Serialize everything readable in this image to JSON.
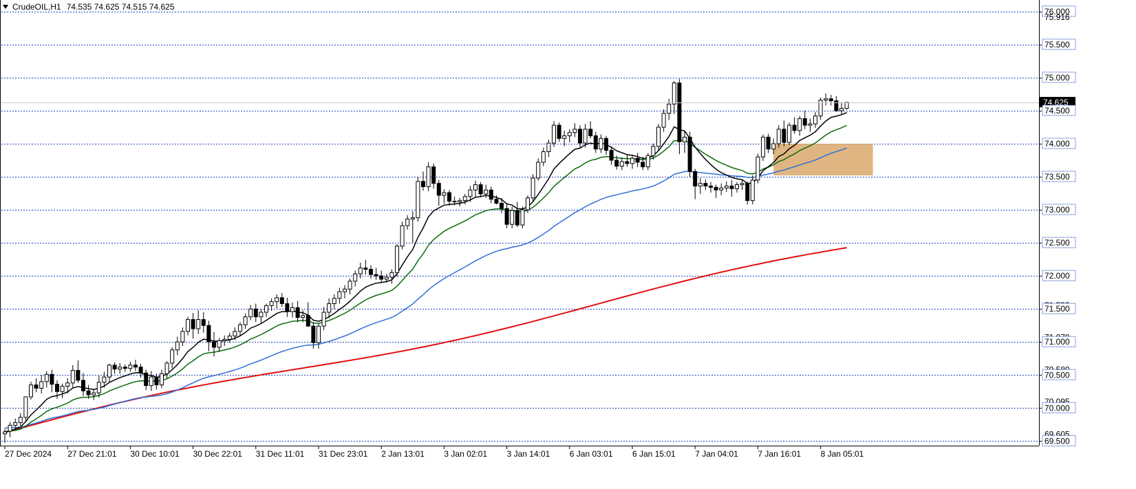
{
  "header": {
    "symbol": "CrudeOIL,H1",
    "ohlc": "74.535 74.625 74.515 74.625"
  },
  "price_scale": {
    "labels": [
      {
        "value": 76.0,
        "text": "76.000",
        "style": "boxed"
      },
      {
        "value": 75.916,
        "text": "75.916",
        "style": "faint"
      },
      {
        "value": 75.5,
        "text": "75.500",
        "style": "boxed"
      },
      {
        "value": 75.0,
        "text": "75.000",
        "style": "boxed"
      },
      {
        "value": 74.625,
        "text": "74.625",
        "style": "current"
      },
      {
        "value": 74.5,
        "text": "74.500",
        "style": "boxed"
      },
      {
        "value": 74.0,
        "text": "74.000",
        "style": "boxed"
      },
      {
        "value": 73.5,
        "text": "73.500",
        "style": "boxed"
      },
      {
        "value": 73.0,
        "text": "73.000",
        "style": "boxed"
      },
      {
        "value": 72.5,
        "text": "72.500",
        "style": "boxed"
      },
      {
        "value": 72.0,
        "text": "72.000",
        "style": "boxed"
      },
      {
        "value": 71.555,
        "text": "71.555",
        "style": "faint"
      },
      {
        "value": 71.5,
        "text": "71.500",
        "style": "boxed"
      },
      {
        "value": 71.07,
        "text": "71.070",
        "style": "faint"
      },
      {
        "value": 71.0,
        "text": "71.000",
        "style": "boxed"
      },
      {
        "value": 70.58,
        "text": "70.580",
        "style": "faint"
      },
      {
        "value": 70.5,
        "text": "70.500",
        "style": "boxed"
      },
      {
        "value": 70.095,
        "text": "70.095",
        "style": "faint"
      },
      {
        "value": 70.0,
        "text": "70.000",
        "style": "boxed"
      },
      {
        "value": 69.605,
        "text": "69.605",
        "style": "faint"
      },
      {
        "value": 69.5,
        "text": "69.500",
        "style": "boxed"
      }
    ]
  },
  "time_axis": {
    "labels": [
      {
        "bar": 0,
        "text": "27 Dec 2024"
      },
      {
        "bar": 12,
        "text": "27 Dec 21:01"
      },
      {
        "bar": 24,
        "text": "30 Dec 10:01"
      },
      {
        "bar": 36,
        "text": "30 Dec 22:01"
      },
      {
        "bar": 48,
        "text": "31 Dec 11:01"
      },
      {
        "bar": 60,
        "text": "31 Dec 23:01"
      },
      {
        "bar": 72,
        "text": "2 Jan 13:01"
      },
      {
        "bar": 84,
        "text": "3 Jan 02:01"
      },
      {
        "bar": 96,
        "text": "3 Jan 14:01"
      },
      {
        "bar": 108,
        "text": "6 Jan 03:01"
      },
      {
        "bar": 120,
        "text": "6 Jan 15:01"
      },
      {
        "bar": 132,
        "text": "7 Jan 04:01"
      },
      {
        "bar": 144,
        "text": "7 Jan 16:01"
      },
      {
        "bar": 156,
        "text": "8 Jan 05:01"
      }
    ]
  },
  "colors": {
    "bull_fill": "#ffffff",
    "bear_fill": "#000000",
    "candle_outline": "#000000",
    "grid": "#1f3fbf",
    "current_price_line": "#c8c8c8",
    "current_price_box": "#000000",
    "zone_fill": "#d9a86c",
    "ma_fast": "#000000",
    "ma_mid": "#0a6b0a",
    "ma_slow": "#2f6fd8",
    "ma_long": "#e01010"
  },
  "chart_data": {
    "type": "candlestick",
    "symbol": "CrudeOIL",
    "timeframe": "H1",
    "ylim": [
      69.41,
      76.05
    ],
    "candles": [
      {
        "o": 69.61,
        "h": 69.69,
        "l": 69.47,
        "c": 69.64
      },
      {
        "o": 69.65,
        "h": 69.79,
        "l": 69.56,
        "c": 69.74
      },
      {
        "o": 69.74,
        "h": 69.84,
        "l": 69.66,
        "c": 69.78
      },
      {
        "o": 69.78,
        "h": 69.92,
        "l": 69.73,
        "c": 69.86
      },
      {
        "o": 69.86,
        "h": 70.08,
        "l": 69.81,
        "c": 70.17
      },
      {
        "o": 70.17,
        "h": 70.4,
        "l": 70.13,
        "c": 70.35
      },
      {
        "o": 70.35,
        "h": 70.45,
        "l": 70.24,
        "c": 70.3
      },
      {
        "o": 70.3,
        "h": 70.5,
        "l": 70.22,
        "c": 70.4
      },
      {
        "o": 70.4,
        "h": 70.56,
        "l": 70.31,
        "c": 70.51
      },
      {
        "o": 70.51,
        "h": 70.58,
        "l": 70.24,
        "c": 70.36
      },
      {
        "o": 70.36,
        "h": 70.42,
        "l": 70.14,
        "c": 70.25
      },
      {
        "o": 70.25,
        "h": 70.37,
        "l": 70.15,
        "c": 70.33
      },
      {
        "o": 70.33,
        "h": 70.45,
        "l": 70.22,
        "c": 70.38
      },
      {
        "o": 70.38,
        "h": 70.65,
        "l": 70.3,
        "c": 70.57
      },
      {
        "o": 70.57,
        "h": 70.72,
        "l": 70.38,
        "c": 70.42
      },
      {
        "o": 70.42,
        "h": 70.53,
        "l": 70.18,
        "c": 70.26
      },
      {
        "o": 70.26,
        "h": 70.35,
        "l": 70.14,
        "c": 70.2
      },
      {
        "o": 70.2,
        "h": 70.28,
        "l": 70.12,
        "c": 70.23
      },
      {
        "o": 70.23,
        "h": 70.49,
        "l": 70.16,
        "c": 70.39
      },
      {
        "o": 70.39,
        "h": 70.55,
        "l": 70.31,
        "c": 70.47
      },
      {
        "o": 70.47,
        "h": 70.67,
        "l": 70.38,
        "c": 70.65
      },
      {
        "o": 70.65,
        "h": 70.69,
        "l": 70.52,
        "c": 70.59
      },
      {
        "o": 70.59,
        "h": 70.68,
        "l": 70.52,
        "c": 70.62
      },
      {
        "o": 70.62,
        "h": 70.66,
        "l": 70.55,
        "c": 70.6
      },
      {
        "o": 70.6,
        "h": 70.7,
        "l": 70.55,
        "c": 70.65
      },
      {
        "o": 70.65,
        "h": 70.73,
        "l": 70.56,
        "c": 70.62
      },
      {
        "o": 70.62,
        "h": 70.67,
        "l": 70.46,
        "c": 70.53
      },
      {
        "o": 70.53,
        "h": 70.58,
        "l": 70.27,
        "c": 70.34
      },
      {
        "o": 70.34,
        "h": 70.56,
        "l": 70.26,
        "c": 70.47
      },
      {
        "o": 70.47,
        "h": 70.52,
        "l": 70.28,
        "c": 70.35
      },
      {
        "o": 70.35,
        "h": 70.58,
        "l": 70.3,
        "c": 70.52
      },
      {
        "o": 70.52,
        "h": 70.71,
        "l": 70.45,
        "c": 70.68
      },
      {
        "o": 70.68,
        "h": 70.92,
        "l": 70.6,
        "c": 70.88
      },
      {
        "o": 70.88,
        "h": 71.08,
        "l": 70.8,
        "c": 71.0
      },
      {
        "o": 71.0,
        "h": 71.22,
        "l": 70.94,
        "c": 71.16
      },
      {
        "o": 71.16,
        "h": 71.38,
        "l": 71.1,
        "c": 71.34
      },
      {
        "o": 71.34,
        "h": 71.44,
        "l": 71.05,
        "c": 71.2
      },
      {
        "o": 71.2,
        "h": 71.48,
        "l": 71.12,
        "c": 71.34
      },
      {
        "o": 71.34,
        "h": 71.45,
        "l": 71.14,
        "c": 71.25
      },
      {
        "o": 71.25,
        "h": 71.32,
        "l": 70.86,
        "c": 71.0
      },
      {
        "o": 71.0,
        "h": 71.15,
        "l": 70.78,
        "c": 70.92
      },
      {
        "o": 70.92,
        "h": 71.06,
        "l": 70.85,
        "c": 71.02
      },
      {
        "o": 71.02,
        "h": 71.1,
        "l": 70.94,
        "c": 71.04
      },
      {
        "o": 71.04,
        "h": 71.14,
        "l": 70.99,
        "c": 71.09
      },
      {
        "o": 71.09,
        "h": 71.22,
        "l": 71.03,
        "c": 71.16
      },
      {
        "o": 71.16,
        "h": 71.3,
        "l": 71.1,
        "c": 71.26
      },
      {
        "o": 71.26,
        "h": 71.43,
        "l": 71.2,
        "c": 71.38
      },
      {
        "o": 71.38,
        "h": 71.56,
        "l": 71.33,
        "c": 71.5
      },
      {
        "o": 71.5,
        "h": 71.58,
        "l": 71.3,
        "c": 71.38
      },
      {
        "o": 71.38,
        "h": 71.5,
        "l": 71.29,
        "c": 71.45
      },
      {
        "o": 71.45,
        "h": 71.58,
        "l": 71.38,
        "c": 71.55
      },
      {
        "o": 71.55,
        "h": 71.66,
        "l": 71.47,
        "c": 71.61
      },
      {
        "o": 71.61,
        "h": 71.72,
        "l": 71.51,
        "c": 71.67
      },
      {
        "o": 71.67,
        "h": 71.74,
        "l": 71.53,
        "c": 71.58
      },
      {
        "o": 71.58,
        "h": 71.67,
        "l": 71.38,
        "c": 71.46
      },
      {
        "o": 71.46,
        "h": 71.6,
        "l": 71.37,
        "c": 71.52
      },
      {
        "o": 71.52,
        "h": 71.62,
        "l": 71.3,
        "c": 71.37
      },
      {
        "o": 71.37,
        "h": 71.48,
        "l": 71.3,
        "c": 71.4
      },
      {
        "o": 71.4,
        "h": 71.6,
        "l": 71.23,
        "c": 71.24
      },
      {
        "o": 71.24,
        "h": 71.3,
        "l": 70.9,
        "c": 70.99
      },
      {
        "o": 70.99,
        "h": 71.28,
        "l": 70.9,
        "c": 71.24
      },
      {
        "o": 71.24,
        "h": 71.53,
        "l": 71.18,
        "c": 71.45
      },
      {
        "o": 71.45,
        "h": 71.66,
        "l": 71.36,
        "c": 71.58
      },
      {
        "o": 71.58,
        "h": 71.72,
        "l": 71.5,
        "c": 71.66
      },
      {
        "o": 71.66,
        "h": 71.82,
        "l": 71.58,
        "c": 71.76
      },
      {
        "o": 71.76,
        "h": 71.86,
        "l": 71.66,
        "c": 71.8
      },
      {
        "o": 71.8,
        "h": 71.96,
        "l": 71.72,
        "c": 71.92
      },
      {
        "o": 71.92,
        "h": 72.08,
        "l": 71.84,
        "c": 72.03
      },
      {
        "o": 72.03,
        "h": 72.2,
        "l": 71.96,
        "c": 72.12
      },
      {
        "o": 72.12,
        "h": 72.24,
        "l": 72.02,
        "c": 72.1
      },
      {
        "o": 72.1,
        "h": 72.16,
        "l": 71.96,
        "c": 72.02
      },
      {
        "o": 72.02,
        "h": 72.12,
        "l": 71.94,
        "c": 72.0
      },
      {
        "o": 72.0,
        "h": 72.08,
        "l": 71.9,
        "c": 71.95
      },
      {
        "o": 71.95,
        "h": 72.03,
        "l": 71.9,
        "c": 71.98
      },
      {
        "o": 71.98,
        "h": 72.1,
        "l": 71.88,
        "c": 72.05
      },
      {
        "o": 72.05,
        "h": 72.48,
        "l": 71.99,
        "c": 72.45
      },
      {
        "o": 72.45,
        "h": 72.82,
        "l": 72.4,
        "c": 72.76
      },
      {
        "o": 72.76,
        "h": 72.92,
        "l": 72.7,
        "c": 72.86
      },
      {
        "o": 72.86,
        "h": 72.98,
        "l": 72.5,
        "c": 72.88
      },
      {
        "o": 72.88,
        "h": 73.5,
        "l": 72.82,
        "c": 73.43
      },
      {
        "o": 73.43,
        "h": 73.58,
        "l": 73.29,
        "c": 73.35
      },
      {
        "o": 73.35,
        "h": 73.72,
        "l": 73.28,
        "c": 73.65
      },
      {
        "o": 73.65,
        "h": 73.7,
        "l": 73.32,
        "c": 73.4
      },
      {
        "o": 73.4,
        "h": 73.45,
        "l": 73.06,
        "c": 73.22
      },
      {
        "o": 73.22,
        "h": 73.31,
        "l": 73.09,
        "c": 73.26
      },
      {
        "o": 73.26,
        "h": 73.3,
        "l": 73.06,
        "c": 73.13
      },
      {
        "o": 73.13,
        "h": 73.2,
        "l": 73.07,
        "c": 73.12
      },
      {
        "o": 73.12,
        "h": 73.18,
        "l": 73.05,
        "c": 73.14
      },
      {
        "o": 73.14,
        "h": 73.24,
        "l": 73.08,
        "c": 73.2
      },
      {
        "o": 73.2,
        "h": 73.36,
        "l": 73.12,
        "c": 73.3
      },
      {
        "o": 73.3,
        "h": 73.44,
        "l": 73.2,
        "c": 73.38
      },
      {
        "o": 73.38,
        "h": 73.42,
        "l": 73.19,
        "c": 73.24
      },
      {
        "o": 73.24,
        "h": 73.38,
        "l": 73.18,
        "c": 73.3
      },
      {
        "o": 73.3,
        "h": 73.35,
        "l": 73.1,
        "c": 73.16
      },
      {
        "o": 73.16,
        "h": 73.22,
        "l": 73.08,
        "c": 73.1
      },
      {
        "o": 73.1,
        "h": 73.18,
        "l": 72.95,
        "c": 73.02
      },
      {
        "o": 73.02,
        "h": 73.08,
        "l": 72.72,
        "c": 72.78
      },
      {
        "o": 72.78,
        "h": 73.05,
        "l": 72.72,
        "c": 72.99
      },
      {
        "o": 72.99,
        "h": 73.12,
        "l": 72.74,
        "c": 72.77
      },
      {
        "o": 72.77,
        "h": 73.05,
        "l": 72.72,
        "c": 73.0
      },
      {
        "o": 73.0,
        "h": 73.22,
        "l": 72.95,
        "c": 73.18
      },
      {
        "o": 73.18,
        "h": 73.54,
        "l": 73.13,
        "c": 73.48
      },
      {
        "o": 73.48,
        "h": 73.78,
        "l": 73.44,
        "c": 73.72
      },
      {
        "o": 73.72,
        "h": 73.94,
        "l": 73.66,
        "c": 73.88
      },
      {
        "o": 73.88,
        "h": 74.06,
        "l": 73.8,
        "c": 74.01
      },
      {
        "o": 74.01,
        "h": 74.34,
        "l": 73.95,
        "c": 74.28
      },
      {
        "o": 74.28,
        "h": 74.32,
        "l": 74.03,
        "c": 74.08
      },
      {
        "o": 74.08,
        "h": 74.2,
        "l": 73.96,
        "c": 74.12
      },
      {
        "o": 74.12,
        "h": 74.22,
        "l": 74.02,
        "c": 74.17
      },
      {
        "o": 74.17,
        "h": 74.31,
        "l": 74.1,
        "c": 74.22
      },
      {
        "o": 74.22,
        "h": 74.28,
        "l": 73.94,
        "c": 74.01
      },
      {
        "o": 74.01,
        "h": 74.3,
        "l": 73.94,
        "c": 74.22
      },
      {
        "o": 74.22,
        "h": 74.34,
        "l": 74.08,
        "c": 74.12
      },
      {
        "o": 74.12,
        "h": 74.18,
        "l": 73.86,
        "c": 73.92
      },
      {
        "o": 73.92,
        "h": 74.14,
        "l": 73.86,
        "c": 74.08
      },
      {
        "o": 74.08,
        "h": 74.12,
        "l": 73.83,
        "c": 73.9
      },
      {
        "o": 73.9,
        "h": 73.96,
        "l": 73.68,
        "c": 73.75
      },
      {
        "o": 73.75,
        "h": 73.82,
        "l": 73.61,
        "c": 73.66
      },
      {
        "o": 73.66,
        "h": 73.79,
        "l": 73.6,
        "c": 73.73
      },
      {
        "o": 73.73,
        "h": 73.84,
        "l": 73.65,
        "c": 73.7
      },
      {
        "o": 73.7,
        "h": 73.82,
        "l": 73.62,
        "c": 73.78
      },
      {
        "o": 73.78,
        "h": 73.86,
        "l": 73.65,
        "c": 73.72
      },
      {
        "o": 73.72,
        "h": 73.8,
        "l": 73.6,
        "c": 73.65
      },
      {
        "o": 73.65,
        "h": 73.86,
        "l": 73.6,
        "c": 73.82
      },
      {
        "o": 73.82,
        "h": 74.0,
        "l": 73.76,
        "c": 73.96
      },
      {
        "o": 73.96,
        "h": 74.3,
        "l": 73.9,
        "c": 74.25
      },
      {
        "o": 74.25,
        "h": 74.52,
        "l": 74.18,
        "c": 74.46
      },
      {
        "o": 74.46,
        "h": 74.68,
        "l": 74.36,
        "c": 74.6
      },
      {
        "o": 74.6,
        "h": 74.95,
        "l": 74.45,
        "c": 74.92
      },
      {
        "o": 74.92,
        "h": 74.98,
        "l": 73.84,
        "c": 74.03
      },
      {
        "o": 74.03,
        "h": 74.19,
        "l": 73.86,
        "c": 74.1
      },
      {
        "o": 74.1,
        "h": 74.18,
        "l": 73.5,
        "c": 73.58
      },
      {
        "o": 73.58,
        "h": 73.62,
        "l": 73.16,
        "c": 73.36
      },
      {
        "o": 73.36,
        "h": 73.48,
        "l": 73.24,
        "c": 73.4
      },
      {
        "o": 73.4,
        "h": 73.46,
        "l": 73.3,
        "c": 73.36
      },
      {
        "o": 73.36,
        "h": 73.42,
        "l": 73.26,
        "c": 73.34
      },
      {
        "o": 73.34,
        "h": 73.38,
        "l": 73.18,
        "c": 73.3
      },
      {
        "o": 73.3,
        "h": 73.4,
        "l": 73.22,
        "c": 73.33
      },
      {
        "o": 73.33,
        "h": 73.43,
        "l": 73.27,
        "c": 73.36
      },
      {
        "o": 73.36,
        "h": 73.45,
        "l": 73.2,
        "c": 73.32
      },
      {
        "o": 73.32,
        "h": 73.42,
        "l": 73.26,
        "c": 73.38
      },
      {
        "o": 73.38,
        "h": 73.46,
        "l": 73.3,
        "c": 73.4
      },
      {
        "o": 73.4,
        "h": 73.43,
        "l": 73.08,
        "c": 73.14
      },
      {
        "o": 73.14,
        "h": 73.52,
        "l": 73.08,
        "c": 73.45
      },
      {
        "o": 73.45,
        "h": 73.85,
        "l": 73.4,
        "c": 73.8
      },
      {
        "o": 73.8,
        "h": 74.14,
        "l": 73.74,
        "c": 74.1
      },
      {
        "o": 74.1,
        "h": 74.15,
        "l": 73.86,
        "c": 73.92
      },
      {
        "o": 73.92,
        "h": 74.08,
        "l": 73.84,
        "c": 74.0
      },
      {
        "o": 74.0,
        "h": 74.28,
        "l": 73.94,
        "c": 74.22
      },
      {
        "o": 74.22,
        "h": 74.35,
        "l": 73.96,
        "c": 74.02
      },
      {
        "o": 74.02,
        "h": 74.32,
        "l": 73.98,
        "c": 74.28
      },
      {
        "o": 74.28,
        "h": 74.4,
        "l": 74.15,
        "c": 74.2
      },
      {
        "o": 74.2,
        "h": 74.42,
        "l": 74.12,
        "c": 74.38
      },
      {
        "o": 74.38,
        "h": 74.5,
        "l": 74.22,
        "c": 74.28
      },
      {
        "o": 74.28,
        "h": 74.38,
        "l": 74.18,
        "c": 74.3
      },
      {
        "o": 74.3,
        "h": 74.48,
        "l": 74.24,
        "c": 74.42
      },
      {
        "o": 74.42,
        "h": 74.7,
        "l": 74.36,
        "c": 74.66
      },
      {
        "o": 74.66,
        "h": 74.76,
        "l": 74.58,
        "c": 74.68
      },
      {
        "o": 74.68,
        "h": 74.74,
        "l": 74.58,
        "c": 74.65
      },
      {
        "o": 74.65,
        "h": 74.72,
        "l": 74.48,
        "c": 74.5
      },
      {
        "o": 74.5,
        "h": 74.63,
        "l": 74.45,
        "c": 74.535
      },
      {
        "o": 74.535,
        "h": 74.625,
        "l": 74.515,
        "c": 74.625
      }
    ],
    "zone": {
      "from_bar": 147,
      "to_bar": 166,
      "top": 74.0,
      "bottom": 73.52
    },
    "current_price": 74.625,
    "moving_averages": [
      {
        "color_key": "ma_fast",
        "period": 10
      },
      {
        "color_key": "ma_mid",
        "period": 20
      },
      {
        "color_key": "ma_slow",
        "period": 50
      },
      {
        "color_key": "ma_long",
        "period": 200
      }
    ]
  }
}
